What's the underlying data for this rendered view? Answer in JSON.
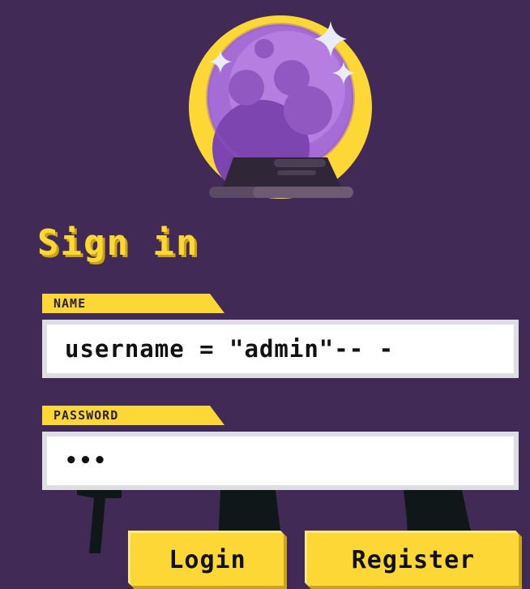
{
  "heading": {
    "title": "Sign in"
  },
  "form": {
    "name_label": "NAME",
    "name_value": "username = \"admin\"-- -",
    "password_label": "PASSWORD",
    "password_value": "•••"
  },
  "buttons": {
    "login_label": "Login",
    "register_label": "Register"
  },
  "icons": {
    "hero": "crystal-ball-icon",
    "sparkles": "sparkle-icon"
  },
  "colors": {
    "background": "#412a55",
    "accent_yellow": "#fdd735",
    "ball_purple": "#a66cd6",
    "input_border": "#dedde3"
  }
}
